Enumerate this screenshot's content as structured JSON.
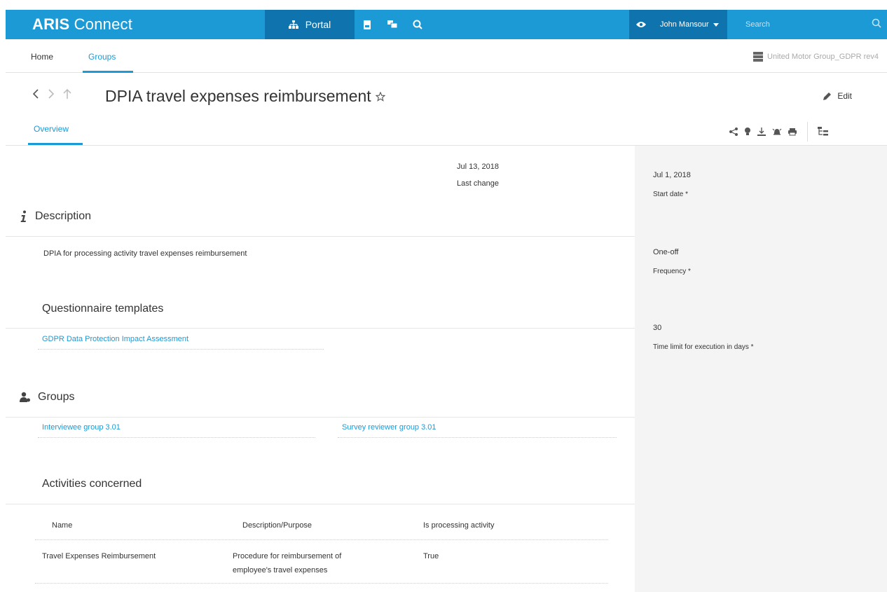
{
  "app": {
    "brand_bold": "ARIS",
    "brand_rest": " Connect"
  },
  "topnav": {
    "portal_label": "Portal",
    "user_name": "John Mansour",
    "search_placeholder": "Search"
  },
  "tabs": [
    {
      "label": "Home"
    },
    {
      "label": "Groups"
    }
  ],
  "database_name": "United Motor Group_GDPR rev4",
  "page": {
    "title": "DPIA travel expenses reimbursement",
    "edit_label": "Edit",
    "overview_tab": "Overview"
  },
  "last_change": {
    "date": "Jul 13, 2018",
    "label": "Last change"
  },
  "description": {
    "heading": "Description",
    "text": "DPIA for processing activity travel expenses reimbursement"
  },
  "questionnaire": {
    "heading": "Questionnaire templates",
    "link": "GDPR Data Protection Impact Assessment"
  },
  "groups": {
    "heading": "Groups",
    "links": [
      "Interviewee group 3.01",
      "Survey reviewer group 3.01"
    ]
  },
  "activities": {
    "heading": "Activities concerned",
    "columns": [
      "Name",
      "Description/Purpose",
      "Is processing activity"
    ],
    "rows": [
      {
        "name": "Travel Expenses Reimbursement",
        "desc_line1": "Procedure for reimbursement of",
        "desc_line2": "employee's travel expenses",
        "processing": "True"
      }
    ]
  },
  "side": {
    "start_date": {
      "value": "Jul 1, 2018",
      "label": "Start date *"
    },
    "frequency": {
      "value": "One-off",
      "label": "Frequency *"
    },
    "time_limit": {
      "value": "30",
      "label": "Time limit for execution in days *"
    }
  },
  "colors": {
    "brand_blue": "#1b9ad6",
    "dark_blue": "#0f74ad",
    "side_bg": "#f4f4f4"
  }
}
